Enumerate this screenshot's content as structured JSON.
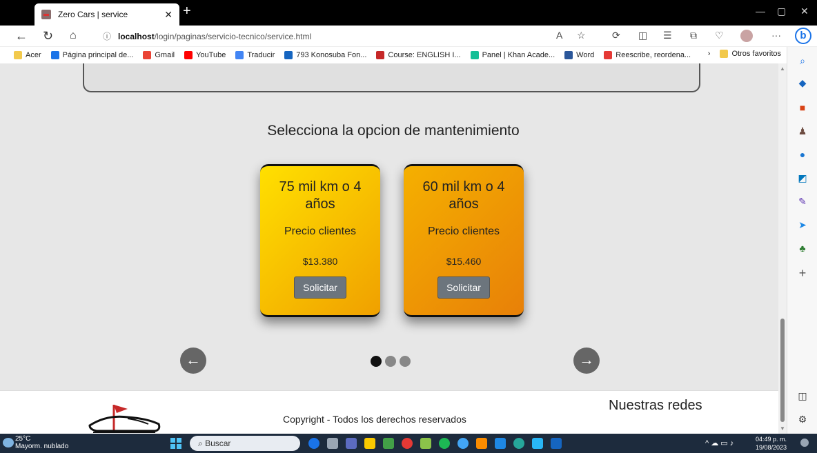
{
  "browser": {
    "tab_title": "Zero Cars | service",
    "url_host": "localhost",
    "url_path": "/login/paginas/servicio-tecnico/service.html"
  },
  "bookmarks": [
    {
      "label": "Acer",
      "icon": "folder-icon",
      "color": "#f2c94c"
    },
    {
      "label": "Página principal de...",
      "icon": "chrome-icon",
      "color": "#1a73e8"
    },
    {
      "label": "Gmail",
      "icon": "gmail-icon",
      "color": "#ea4335"
    },
    {
      "label": "YouTube",
      "icon": "youtube-icon",
      "color": "#ff0000"
    },
    {
      "label": "Traducir",
      "icon": "translate-icon",
      "color": "#4285f4"
    },
    {
      "label": "793 Konosuba Fon...",
      "icon": "bookmark-icon",
      "color": "#1565c0"
    },
    {
      "label": "Course: ENGLISH I...",
      "icon": "course-icon",
      "color": "#c62828"
    },
    {
      "label": "Panel | Khan Acade...",
      "icon": "khan-icon",
      "color": "#14bf96"
    },
    {
      "label": "Word",
      "icon": "word-icon",
      "color": "#2b579a"
    },
    {
      "label": "Reescribe, reordena...",
      "icon": "rewrite-icon",
      "color": "#e53935"
    }
  ],
  "bookmarks_right": "Otros favoritos",
  "page": {
    "section_title": "Selecciona la opcion de mantenimiento",
    "cards": [
      {
        "title": "75 mil km o 4 años",
        "subtitle": "Precio clientes",
        "price": "$13.380",
        "button": "Solicitar"
      },
      {
        "title": "60 mil km o 4 años",
        "subtitle": "Precio clientes",
        "price": "$15.460",
        "button": "Solicitar"
      }
    ],
    "footer_copyright": "Copyright - Todos los derechos reservados",
    "footer_social": "Nuestras redes"
  },
  "taskbar": {
    "weather_temp": "25°C",
    "weather_desc": "Mayorm. nublado",
    "search_placeholder": "Buscar",
    "time": "04:49 p. m.",
    "date": "19/08/2023"
  }
}
